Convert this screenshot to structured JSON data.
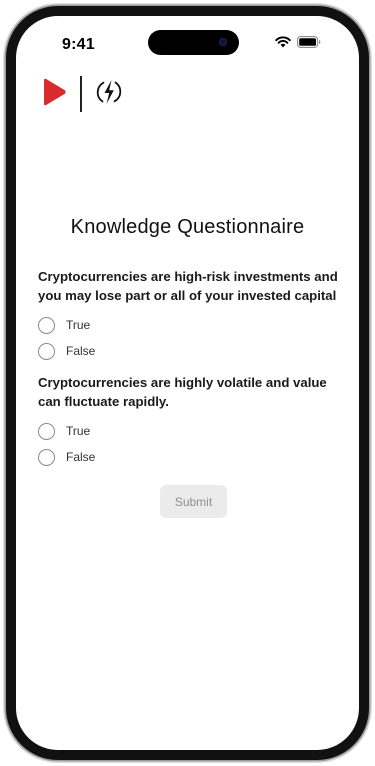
{
  "status_bar": {
    "time": "9:41",
    "icons": [
      "wifi-icon",
      "battery-icon"
    ]
  },
  "brand": {
    "logo_icons": [
      "play-logo-icon",
      "lightning-logo-icon"
    ],
    "play_color": "#d92b2b"
  },
  "page": {
    "title": "Knowledge Questionnaire"
  },
  "questions": [
    {
      "text": "Cryptocurrencies are high-risk investments and you may lose part or all of your invested capital",
      "options": [
        "True",
        "False"
      ]
    },
    {
      "text": "Cryptocurrencies are highly volatile and value can fluctuate rapidly.",
      "options": [
        "True",
        "False"
      ]
    }
  ],
  "submit": {
    "label": "Submit",
    "state": "disabled"
  },
  "colors": {
    "frame": "#111111",
    "text": "#1a1a1a",
    "radio_border": "#8a8a8a",
    "button_bg": "#ebebeb",
    "button_text": "#8f8f8f"
  }
}
